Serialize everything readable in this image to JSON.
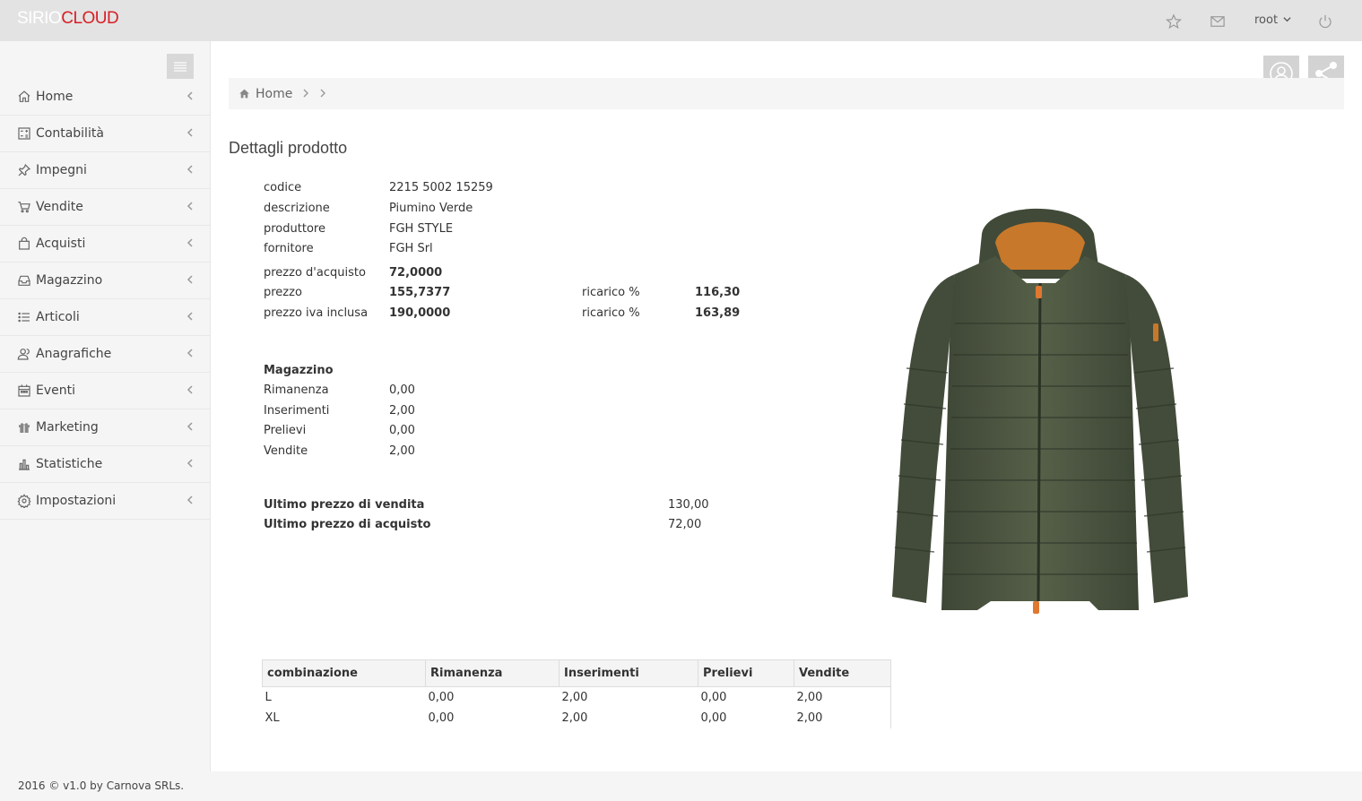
{
  "app": {
    "logo_part1": "SIRIO",
    "logo_part2": "CLOUD"
  },
  "topbar": {
    "user": "root"
  },
  "sidebar": {
    "items": [
      {
        "label": "Home",
        "icon": "home-icon"
      },
      {
        "label": "Contabilità",
        "icon": "calculator-icon"
      },
      {
        "label": "Impegni",
        "icon": "pin-icon"
      },
      {
        "label": "Vendite",
        "icon": "cart-icon"
      },
      {
        "label": "Acquisti",
        "icon": "bag-icon"
      },
      {
        "label": "Magazzino",
        "icon": "inbox-icon"
      },
      {
        "label": "Articoli",
        "icon": "list-icon"
      },
      {
        "label": "Anagrafiche",
        "icon": "users-icon"
      },
      {
        "label": "Eventi",
        "icon": "calendar-icon"
      },
      {
        "label": "Marketing",
        "icon": "gift-icon"
      },
      {
        "label": "Statistiche",
        "icon": "bar-chart-icon"
      },
      {
        "label": "Impostazioni",
        "icon": "gear-icon"
      }
    ]
  },
  "breadcrumb": {
    "home": "Home"
  },
  "page": {
    "title": "Dettagli prodotto"
  },
  "product": {
    "codice_label": "codice",
    "codice": "2215 5002 15259",
    "descrizione_label": "descrizione",
    "descrizione": "Piumino Verde",
    "produttore_label": "produttore",
    "produttore": "FGH STYLE",
    "fornitore_label": "fornitore",
    "fornitore": "FGH Srl",
    "prezzo_acquisto_label": "prezzo d'acquisto",
    "prezzo_acquisto": "72,0000",
    "prezzo_label": "prezzo",
    "prezzo": "155,7377",
    "prezzo_iva_label": "prezzo iva inclusa",
    "prezzo_iva": "190,0000",
    "ricarico_label": "ricarico %",
    "ricarico1": "116,30",
    "ricarico2": "163,89"
  },
  "magazzino": {
    "title": "Magazzino",
    "rimanenza_label": "Rimanenza",
    "rimanenza": "0,00",
    "inserimenti_label": "Inserimenti",
    "inserimenti": "2,00",
    "prelievi_label": "Prelievi",
    "prelievi": "0,00",
    "vendite_label": "Vendite",
    "vendite": "2,00"
  },
  "ultimi": {
    "vendita_label": "Ultimo prezzo di vendita",
    "vendita": "130,00",
    "acquisto_label": "Ultimo prezzo di acquisto",
    "acquisto": "72,00"
  },
  "table": {
    "headers": [
      "combinazione",
      "Rimanenza",
      "Inserimenti",
      "Prelievi",
      "Vendite"
    ],
    "rows": [
      [
        "L",
        "0,00",
        "2,00",
        "0,00",
        "2,00"
      ],
      [
        "XL",
        "0,00",
        "2,00",
        "0,00",
        "2,00"
      ]
    ]
  },
  "footer": {
    "text": "2016 © v1.0 by Carnova SRLs."
  },
  "colors": {
    "brand_red": "#d71f26",
    "topbar_bg": "#e3e3e3",
    "jacket_green": "#4a5340",
    "jacket_lining": "#c8782a"
  }
}
